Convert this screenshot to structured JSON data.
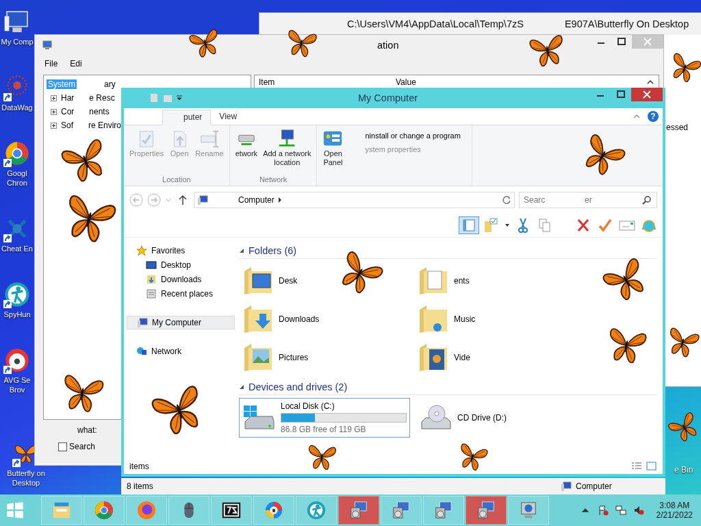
{
  "desktop_icons": [
    {
      "kind": "computer",
      "lines": [
        "My Comp"
      ]
    },
    {
      "kind": "datawag",
      "lines": [
        "DataWag"
      ]
    },
    {
      "kind": "chrome",
      "lines": [
        "Googl",
        "Chron"
      ]
    },
    {
      "kind": "cheat",
      "lines": [
        "Cheat En"
      ]
    },
    {
      "kind": "spyhunter",
      "lines": [
        "SpyHun"
      ]
    },
    {
      "kind": "avg",
      "lines": [
        "AVG Se",
        "Brov"
      ]
    },
    {
      "kind": "butterfly",
      "lines": [
        "Butterfly on",
        "Desktop"
      ]
    }
  ],
  "recycle_label": "e Bin",
  "path_window": {
    "title_start": "C:\\Users\\VM4\\AppData\\Local\\Temp\\7zS",
    "title_end": "E907A\\Butterfly On Desktop",
    "list_text": "essed"
  },
  "sysinfo_window": {
    "title": "ation",
    "menu": [
      "File",
      "Edi"
    ],
    "tree": [
      {
        "label": "System",
        "tail": "ary",
        "selected": true,
        "children": [
          {
            "label": "Har",
            "tail": "e Resc",
            "selected": false,
            "expanded": false
          },
          {
            "label": "Cor",
            "tail": "nents",
            "selected": false,
            "expanded": false
          },
          {
            "label": "Sof",
            "tail": "re Enviro",
            "selected": false,
            "expanded": false
          }
        ]
      }
    ],
    "columns": [
      "Item",
      "Value"
    ],
    "find_label": "what:",
    "search_checkbox": {
      "label": "Search",
      "checked": false
    }
  },
  "explorer": {
    "title": "My Computer",
    "tabs": [
      {
        "label": "puter",
        "selected": true
      },
      {
        "label": "View",
        "selected": false
      }
    ],
    "help_label": "?",
    "ribbon_groups": [
      {
        "label": "Location",
        "buttons": [
          {
            "lines": [
              "Properties"
            ],
            "disabled": true
          },
          {
            "lines": [
              "Open"
            ],
            "disabled": true
          },
          {
            "lines": [
              "Rename"
            ],
            "disabled": true
          }
        ]
      },
      {
        "label": "Network",
        "buttons": [
          {
            "lines": [
              "etwork"
            ],
            "disabled": false
          },
          {
            "lines": [
              "Add a network",
              "location"
            ],
            "disabled": false
          }
        ]
      },
      {
        "buttons": [
          {
            "lines": [
              "Open",
              "Panel"
            ],
            "disabled": false
          }
        ],
        "commands": [
          {
            "label": "ninstall or change a program",
            "disabled": false
          },
          {
            "label": "ystem properties",
            "disabled": true
          }
        ]
      }
    ],
    "address": "Computer",
    "search_placeholder": "Searc",
    "search_tail": "er",
    "nav": [
      {
        "kind": "header",
        "label": "Favorites",
        "selected": false
      },
      {
        "kind": "item",
        "label": "Desktop",
        "selected": false
      },
      {
        "kind": "item",
        "label": "Downloads",
        "selected": false
      },
      {
        "kind": "item",
        "label": "Recent places",
        "selected": false
      },
      {
        "kind": "header",
        "label": "My Computer",
        "selected": true
      },
      {
        "kind": "header",
        "label": "Network",
        "selected": false
      }
    ],
    "folders_title": "Folders (6)",
    "folders": [
      {
        "label": "Desk"
      },
      {
        "label": "ents"
      },
      {
        "label": "Downloads"
      },
      {
        "label": "Music"
      },
      {
        "label": "Pictures"
      },
      {
        "label": "Vide"
      }
    ],
    "drives_title": "Devices and drives (2)",
    "drives": [
      {
        "kind": "disk",
        "label": "Local Disk (C:)",
        "level": 0.27,
        "free": "86.8 GB free of 119 GB",
        "selected": true
      },
      {
        "kind": "cd",
        "label": "CD Drive (D:)",
        "selected": false
      }
    ],
    "status": "items"
  },
  "lower_status": {
    "count": "8 items",
    "location": "Computer"
  },
  "taskbar": {
    "apps": [
      {
        "kind": "explorer",
        "flashing": false
      },
      {
        "kind": "chrome",
        "flashing": false
      },
      {
        "kind": "firefox",
        "flashing": false
      },
      {
        "kind": "mouse",
        "flashing": false
      },
      {
        "kind": "archive",
        "flashing": false
      },
      {
        "kind": "browser",
        "flashing": false
      },
      {
        "kind": "spyhunter",
        "flashing": false
      },
      {
        "kind": "installer",
        "flashing": true
      },
      {
        "kind": "installer",
        "flashing": false
      },
      {
        "kind": "installer",
        "flashing": false
      },
      {
        "kind": "installer",
        "flashing": true
      },
      {
        "kind": "info",
        "flashing": false
      }
    ],
    "time": "3:08 AM",
    "date": "2/21/2022"
  }
}
